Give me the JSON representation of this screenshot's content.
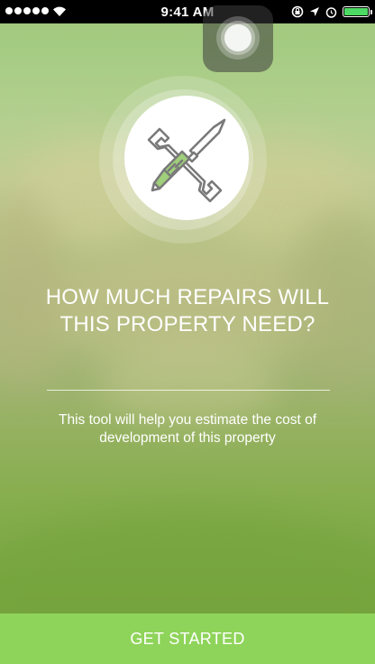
{
  "status_bar": {
    "time": "9:41 AM",
    "signal_bars": 5,
    "battery_level": 1.0,
    "icons": [
      "signal-icon",
      "wifi-icon",
      "rotation-lock-icon",
      "location-icon",
      "alarm-icon",
      "battery-icon"
    ]
  },
  "hero": {
    "icon": "tools-icon",
    "headline": "HOW MUCH REPAIRS WILL THIS PROPERTY NEED?",
    "subtitle": "This tool will help you estimate the cost of development of this property"
  },
  "footer": {
    "cta_label": "GET STARTED"
  },
  "colors": {
    "accent": "#8fd45a",
    "icon_fill": "#ffffff",
    "icon_stroke": "#7a7a7a",
    "handle_green": "#9fcf7a"
  }
}
